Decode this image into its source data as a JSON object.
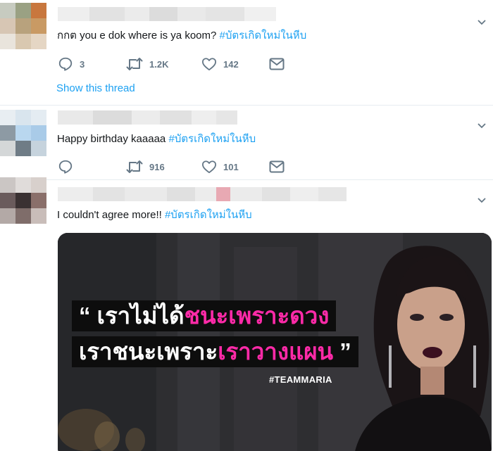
{
  "tweets": [
    {
      "text_prefix": "กกต you e dok where is ya koom? ",
      "hashtag": "#บัตรเกิดใหม่ในหีบ",
      "reply_count": "3",
      "retweet_count": "1.2K",
      "like_count": "142",
      "show_thread": "Show this thread"
    },
    {
      "text_prefix": "Happy birthday kaaaaa ",
      "hashtag": "#บัตรเกิดใหม่ในหีบ",
      "reply_count": "",
      "retweet_count": "916",
      "like_count": "101"
    },
    {
      "text_prefix": "I couldn't agree more!! ",
      "hashtag": "#บัตรเกิดใหม่ในหีบ",
      "media": {
        "line1_open_quote": "“",
        "line1_white": " เราไม่ได้",
        "line1_pink": "ชนะเพราะดวง",
        "line2_white": "เราชนะเพราะ",
        "line2_pink": "เราวางแผน",
        "line2_close_quote": " ”",
        "tag": "#TEAMMARIA"
      }
    }
  ],
  "colors": {
    "accent": "#1da1f2",
    "icon_gray": "#657786",
    "highlight_pink": "#ff2aa8"
  },
  "icons": [
    "reply-icon",
    "retweet-icon",
    "like-icon",
    "direct-message-icon",
    "chevron-down-icon"
  ]
}
